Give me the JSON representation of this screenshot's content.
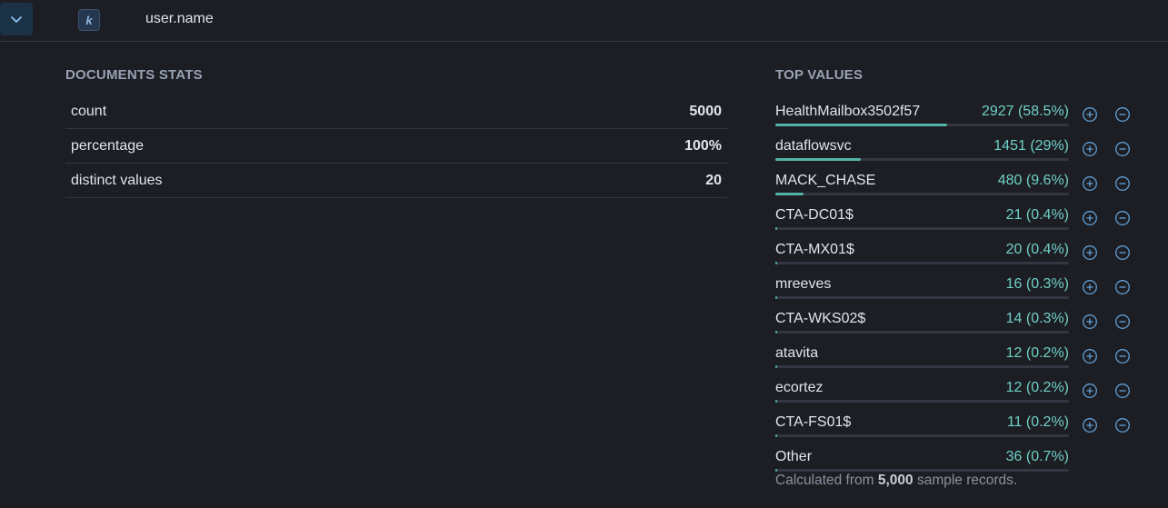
{
  "header": {
    "field_type_token": "k",
    "field_name": "user.name"
  },
  "document_stats": {
    "title": "DOCUMENTS STATS",
    "rows": [
      {
        "label": "count",
        "value": "5000"
      },
      {
        "label": "percentage",
        "value": "100%"
      },
      {
        "label": "distinct values",
        "value": "20"
      }
    ]
  },
  "top_values": {
    "title": "TOP VALUES",
    "items": [
      {
        "name": "HealthMailbox3502f57",
        "count": "2927 (58.5%)",
        "percent": 58.5,
        "filterable": true
      },
      {
        "name": "dataflowsvc",
        "count": "1451 (29%)",
        "percent": 29,
        "filterable": true
      },
      {
        "name": "MACK_CHASE",
        "count": "480 (9.6%)",
        "percent": 9.6,
        "filterable": true
      },
      {
        "name": "CTA-DC01$",
        "count": "21 (0.4%)",
        "percent": 0.4,
        "filterable": true
      },
      {
        "name": "CTA-MX01$",
        "count": "20 (0.4%)",
        "percent": 0.4,
        "filterable": true
      },
      {
        "name": "mreeves",
        "count": "16 (0.3%)",
        "percent": 0.3,
        "filterable": true
      },
      {
        "name": "CTA-WKS02$",
        "count": "14 (0.3%)",
        "percent": 0.3,
        "filterable": true
      },
      {
        "name": "atavita",
        "count": "12 (0.2%)",
        "percent": 0.2,
        "filterable": true
      },
      {
        "name": "ecortez",
        "count": "12 (0.2%)",
        "percent": 0.2,
        "filterable": true
      },
      {
        "name": "CTA-FS01$",
        "count": "11 (0.2%)",
        "percent": 0.2,
        "filterable": true
      },
      {
        "name": "Other",
        "count": "36 (0.7%)",
        "percent": 0.7,
        "filterable": false
      }
    ],
    "footnote_prefix": "Calculated from ",
    "footnote_sample": "5,000",
    "footnote_suffix": " sample records."
  },
  "colors": {
    "background": "#1d1e24",
    "accent_teal": "#6ed0c6",
    "bar_fill": "#54b3a7",
    "icon_blue": "#5f9fd6"
  },
  "icons": {
    "toggle": "chevron-down-icon",
    "filter_in": "plus-circle-icon",
    "filter_out": "minus-circle-icon"
  }
}
